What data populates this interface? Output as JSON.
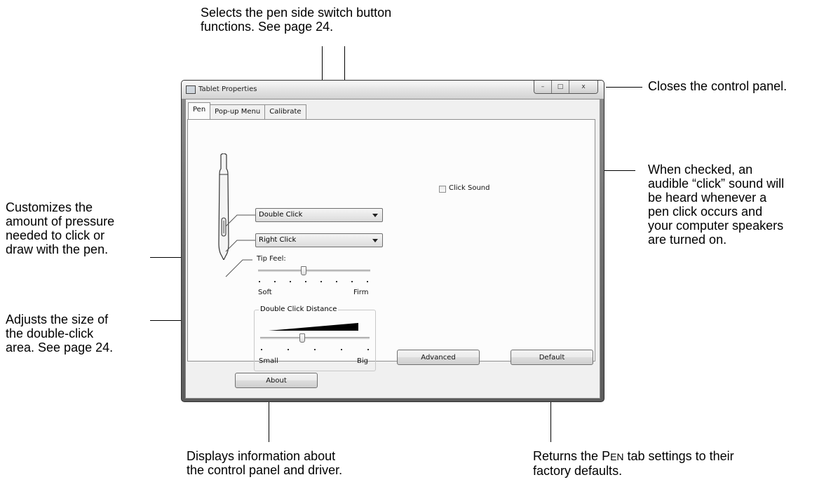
{
  "window": {
    "title": "Tablet Properties",
    "controls": {
      "minimize": "–",
      "maximize": "□",
      "close": "x"
    }
  },
  "tabs": [
    {
      "label": "Pen",
      "active": true
    },
    {
      "label": "Pop-up Menu",
      "active": false
    },
    {
      "label": "Calibrate",
      "active": false
    }
  ],
  "pen_panel": {
    "upper_switch": "Double Click",
    "lower_switch": "Right Click",
    "tip_feel": {
      "label": "Tip Feel:",
      "min_label": "Soft",
      "max_label": "Firm",
      "level_fraction": 0.4
    },
    "double_click_distance": {
      "label": "Double Click Distance",
      "min_label": "Small",
      "max_label": "Big",
      "level_fraction": 0.4
    },
    "click_sound": {
      "label": "Click Sound",
      "checked": false
    },
    "advanced_button": "Advanced",
    "default_button": "Default"
  },
  "footer": {
    "about_button": "About"
  },
  "callouts": {
    "top": [
      "Selects the pen side switch button",
      "functions.  See page 24."
    ],
    "close": [
      "Closes the control panel."
    ],
    "click_sound": [
      "When checked, an",
      "audible “click” sound will",
      "be heard whenever a",
      "pen click occurs and",
      "your computer speakers",
      "are turned on."
    ],
    "tip_feel": [
      "Customizes the",
      "amount of pressure",
      "needed to click or",
      "draw with the pen."
    ],
    "double_click": [
      "Adjusts the size of",
      "the double-click",
      "area.  See page 24."
    ],
    "about": [
      "Displays information about",
      "the control panel and driver."
    ],
    "default_prefix": "Returns the ",
    "default_p": "P",
    "default_en": "EN",
    "default_suffix": " tab settings to their",
    "default_line2": "factory defaults."
  }
}
